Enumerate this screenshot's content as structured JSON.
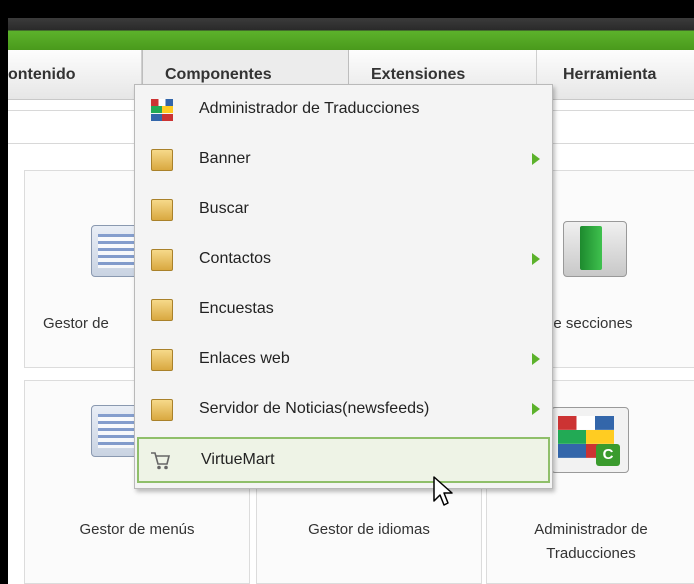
{
  "menubar": {
    "tabs": [
      {
        "label": "ontenido"
      },
      {
        "label": "Componentes"
      },
      {
        "label": "Extensiones"
      },
      {
        "label": "Herramienta"
      }
    ]
  },
  "cards": {
    "top_left_label": "Gestor de",
    "top_right_label": "de secciones",
    "bottom_1_label": "Gestor de menús",
    "bottom_2_label": "Gestor de idiomas",
    "bottom_3_line1": "Administrador de",
    "bottom_3_line2": "Traducciones"
  },
  "dropdown": {
    "items": [
      {
        "label": "Administrador de Traducciones",
        "icon": "flags-icon",
        "submenu": false
      },
      {
        "label": "Banner",
        "icon": "folder-icon",
        "submenu": true
      },
      {
        "label": "Buscar",
        "icon": "folder-icon",
        "submenu": false
      },
      {
        "label": "Contactos",
        "icon": "folder-icon",
        "submenu": true
      },
      {
        "label": "Encuestas",
        "icon": "folder-icon",
        "submenu": false
      },
      {
        "label": "Enlaces web",
        "icon": "folder-icon",
        "submenu": true
      },
      {
        "label": "Servidor de Noticias(newsfeeds)",
        "icon": "folder-icon",
        "submenu": true
      },
      {
        "label": "VirtueMart",
        "icon": "cart-icon",
        "submenu": false,
        "highlighted": true
      }
    ]
  },
  "colors": {
    "accent_green": "#5cb22b",
    "highlight_border": "#8fbf6a"
  }
}
